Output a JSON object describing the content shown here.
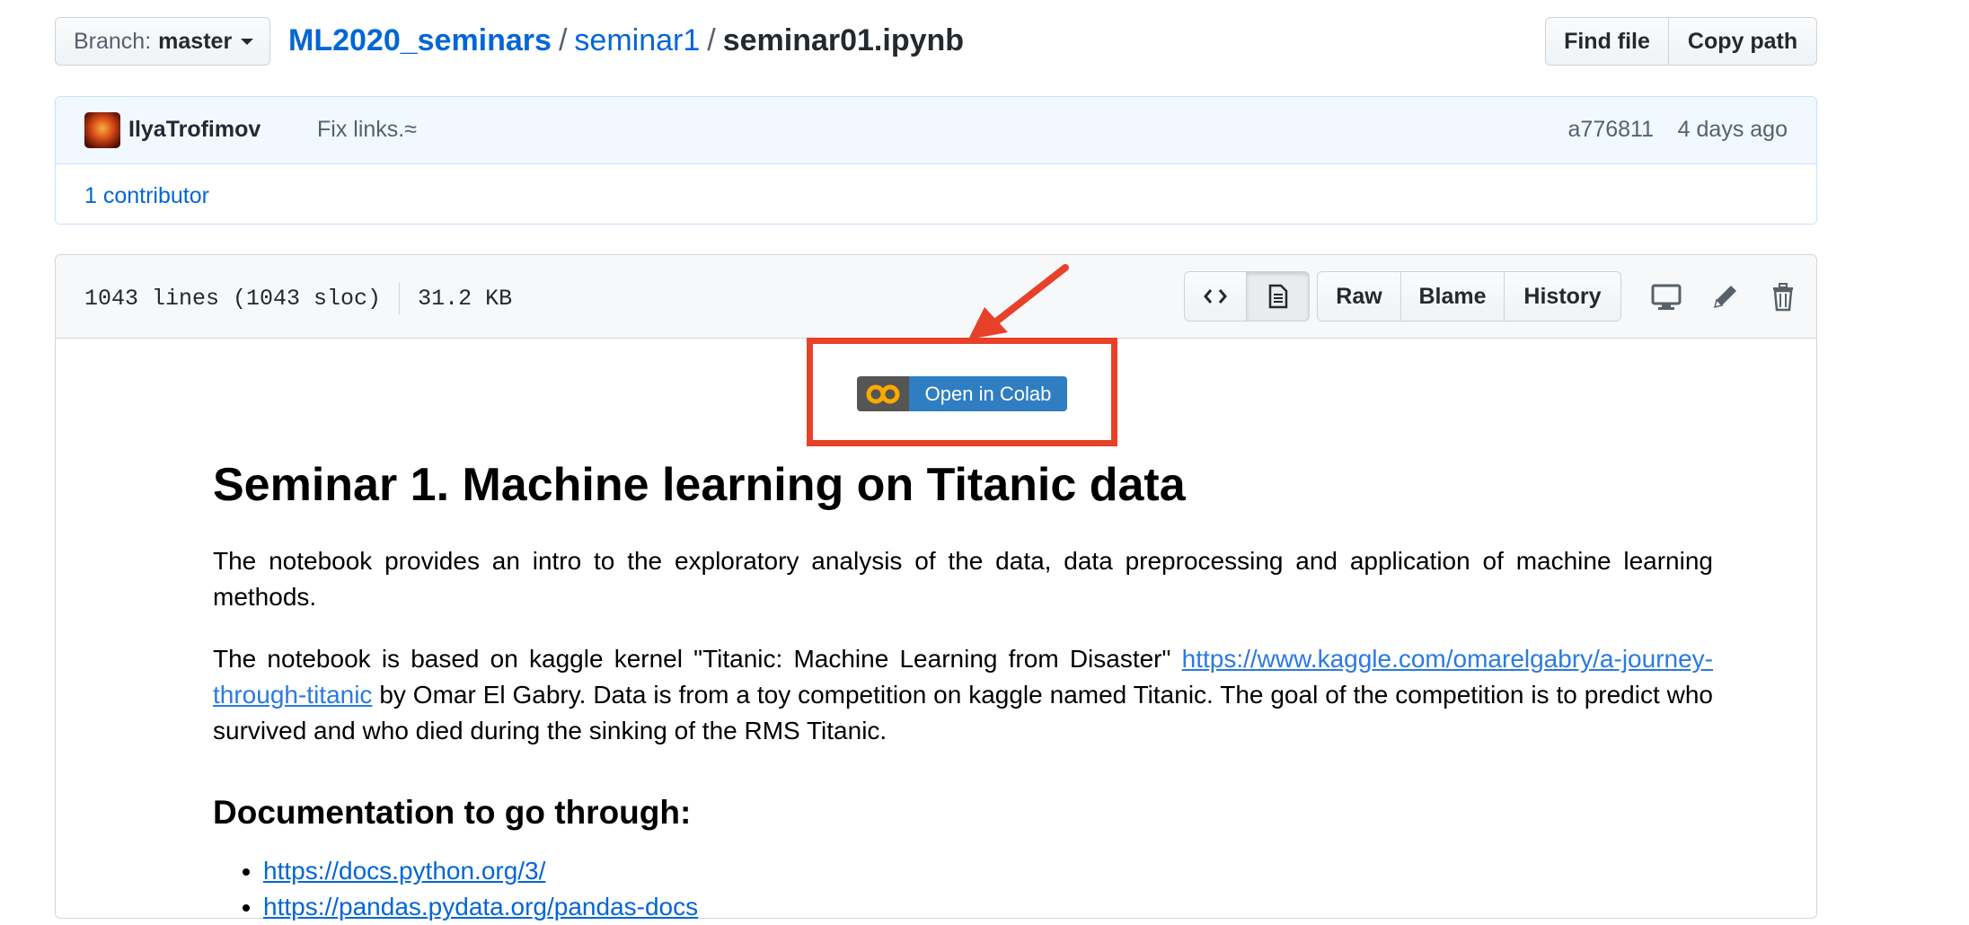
{
  "branch": {
    "prefix": "Branch:",
    "name": "master"
  },
  "breadcrumb": {
    "repo": "ML2020_seminars",
    "sep1": "/",
    "dir": "seminar1",
    "sep2": "/",
    "file": "seminar01.ipynb"
  },
  "file_actions": {
    "find_file": "Find file",
    "copy_path": "Copy path"
  },
  "commit": {
    "author": "IlyaTrofimov",
    "message": "Fix links.",
    "ellipsis": "≈",
    "sha": "a776811",
    "time": "4 days ago",
    "contributors": "1 contributor"
  },
  "file_header": {
    "lines": "1043 lines (1043 sloc)",
    "size": "31.2 KB",
    "raw": "Raw",
    "blame": "Blame",
    "history": "History"
  },
  "colab_badge": {
    "logo_text": "CO",
    "label": "Open in Colab"
  },
  "notebook": {
    "title": "Seminar 1. Machine learning on Titanic data",
    "para1": "The notebook provides an intro to the exploratory analysis of the data, data preprocessing and application of machine learning methods.",
    "para2_before": "The notebook is based on kaggle kernel \"Titanic: Machine Learning from Disaster\" ",
    "para2_link": "https://www.kaggle.com/omarelgabry/a-journey-through-titanic",
    "para2_after": " by Omar El Gabry. Data is from a toy competition on kaggle named Titanic. The goal of the competition is to predict who survived and who died during the sinking of the RMS Titanic.",
    "docs_heading": "Documentation to go through:",
    "docs_links": [
      "https://docs.python.org/3/",
      "https://pandas.pydata.org/pandas-docs"
    ]
  },
  "colors": {
    "highlight": "#e8412a",
    "link": "#0366d6",
    "colab_blue": "#2f7ec2"
  }
}
